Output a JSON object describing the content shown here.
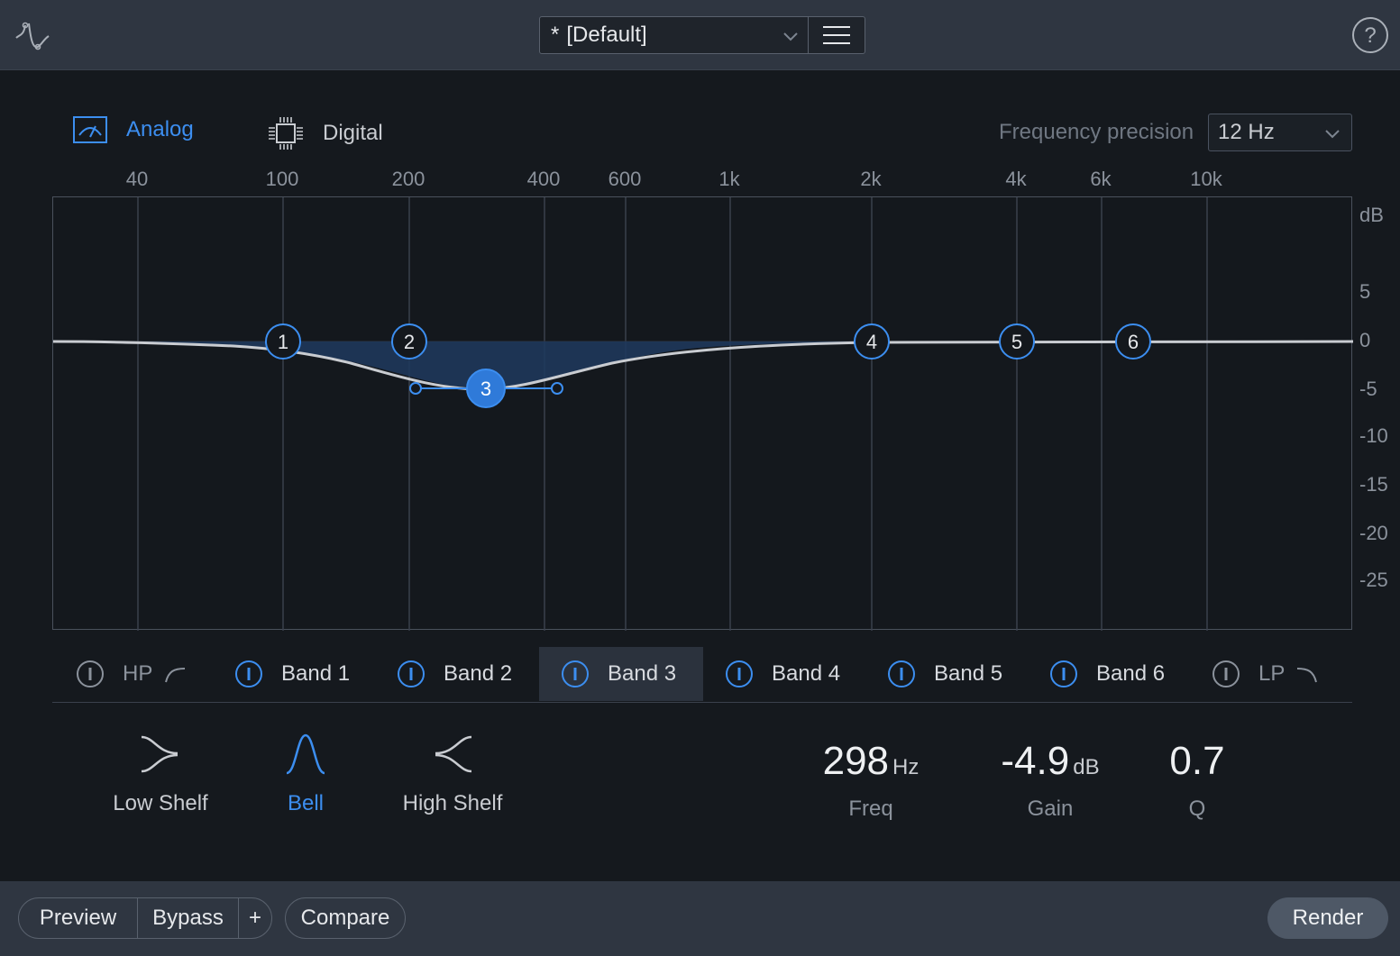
{
  "header": {
    "preset_modified_marker": "*",
    "preset_name": "[Default]",
    "logo_icon": "eq-curve-logo-icon",
    "menu_icon": "hamburger-menu-icon",
    "help_icon": "help-circle-icon"
  },
  "mode": {
    "analog_label": "Analog",
    "digital_label": "Digital",
    "selected": "Analog",
    "analog_icon": "analog-meter-icon",
    "digital_icon": "chip-icon"
  },
  "frequency_precision": {
    "label": "Frequency precision",
    "value": "12 Hz"
  },
  "graph": {
    "freq_labels": [
      "40",
      "100",
      "200",
      "400",
      "600",
      "1k",
      "2k",
      "4k",
      "6k",
      "10k"
    ],
    "db_labels": [
      "dB",
      "5",
      "0",
      "-5",
      "-10",
      "-15",
      "-20",
      "-25"
    ],
    "nodes": [
      "1",
      "2",
      "3",
      "4",
      "5",
      "6"
    ],
    "selected_node": "3"
  },
  "bands": {
    "hp": "HP",
    "band1": "Band 1",
    "band2": "Band 2",
    "band3": "Band 3",
    "band4": "Band 4",
    "band5": "Band 5",
    "band6": "Band 6",
    "lp": "LP",
    "selected": "Band 3"
  },
  "shapes": {
    "low_shelf": "Low Shelf",
    "bell": "Bell",
    "high_shelf": "High Shelf",
    "selected": "Bell"
  },
  "params": {
    "freq_value": "298",
    "freq_unit": "Hz",
    "freq_label": "Freq",
    "gain_value": "-4.9",
    "gain_unit": "dB",
    "gain_label": "Gain",
    "q_value": "0.7",
    "q_label": "Q"
  },
  "footer": {
    "preview": "Preview",
    "bypass": "Bypass",
    "plus": "+",
    "compare": "Compare",
    "render": "Render"
  },
  "colors": {
    "accent": "#3c8ef0",
    "background": "#15191e",
    "bar": "#2f3641"
  }
}
